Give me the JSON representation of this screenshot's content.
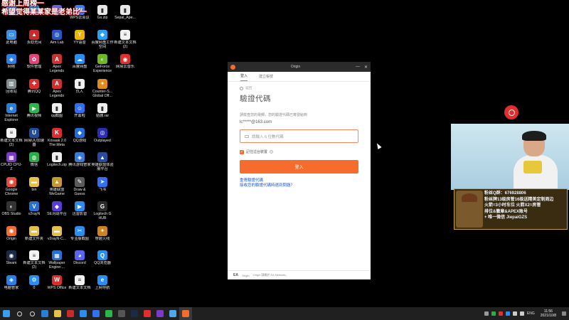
{
  "overlay_text": {
    "line1": "感谢上周榜一",
    "line2": "希望觉得某某家是老弟比一"
  },
  "desktop_icons": [
    {
      "label": "",
      "color": "#1e88e5",
      "glyph": "▣"
    },
    {
      "label": "",
      "color": "#1e88e5",
      "glyph": "▣"
    },
    {
      "label": "",
      "color": "#5b6bd6",
      "glyph": "✦"
    },
    {
      "label": "WPS云会议",
      "color": "#3b7cf5",
      "glyph": "W"
    },
    {
      "label": "Gs.zip",
      "color": "#e8e8e8",
      "glyph": "▮"
    },
    {
      "label": "Sepal_Ape...",
      "color": "#e8e8e8",
      "glyph": "▮"
    },
    {
      "label": "此电脑",
      "color": "#3a8ee6",
      "glyph": "▭"
    },
    {
      "label": "永劫无间",
      "color": "#c92a2a",
      "glyph": "▲"
    },
    {
      "label": "Aim Lab",
      "color": "#2756c4",
      "glyph": "◎"
    },
    {
      "label": "YY语音",
      "color": "#f0b400",
      "glyph": "Y"
    },
    {
      "label": "百度网盘工作空间",
      "color": "#27a1f5",
      "glyph": "◆"
    },
    {
      "label": "新建文本文档(2)",
      "color": "#f2f2f2",
      "glyph": "≡"
    },
    {
      "label": "网络",
      "color": "#2f7de1",
      "glyph": "◈"
    },
    {
      "label": "软件管理",
      "color": "#e2457a",
      "glyph": "✿"
    },
    {
      "label": "Apex Legends",
      "color": "#c83232",
      "glyph": "A"
    },
    {
      "label": "百度网盘",
      "color": "#2a8ef0",
      "glyph": "☁"
    },
    {
      "label": "GeForce Experience",
      "color": "#6fb62b",
      "glyph": "◐"
    },
    {
      "label": "网易云音乐",
      "color": "#e02f2f",
      "glyph": "◉"
    },
    {
      "label": "回收站",
      "color": "#7f8c8d",
      "glyph": "▥"
    },
    {
      "label": "腾讯QQ",
      "color": "#d62f2f",
      "glyph": "✚"
    },
    {
      "label": "Apex Legends",
      "color": "#c83232",
      "glyph": "A"
    },
    {
      "label": "仇人",
      "color": "#eeeeee",
      "glyph": "▮"
    },
    {
      "label": "Counter-S... Global Off...",
      "color": "#e28a1c",
      "glyph": "✦"
    },
    {
      "label": "",
      "color": "#000000",
      "glyph": ""
    },
    {
      "label": "Internet Explorer",
      "color": "#2a7fd4",
      "glyph": "e"
    },
    {
      "label": "腾讯视频",
      "color": "#2cb64a",
      "glyph": "▶"
    },
    {
      "label": "qq截图",
      "color": "#eeeeee",
      "glyph": "▮"
    },
    {
      "label": "开黑啦",
      "color": "#2d6ff0",
      "glyph": "☺"
    },
    {
      "label": "骷髅.rar",
      "color": "#eeeeee",
      "glyph": "▮"
    },
    {
      "label": "",
      "color": "#000000",
      "glyph": ""
    },
    {
      "label": "新建文本文档(2)",
      "color": "#f2f2f2",
      "glyph": "≡"
    },
    {
      "label": "网易UU加速器",
      "color": "#224a9a",
      "glyph": "U"
    },
    {
      "label": "Kovaak 2.0 The Meta",
      "color": "#d92e2e",
      "glyph": "K"
    },
    {
      "label": "QQ游戏",
      "color": "#1f6fd8",
      "glyph": "◆"
    },
    {
      "label": "Outplayed",
      "color": "#2c2cb4",
      "glyph": "◎"
    },
    {
      "label": "",
      "color": "#000000",
      "glyph": ""
    },
    {
      "label": "CPUID CPU-Z",
      "color": "#7c3ac9",
      "glyph": "▦"
    },
    {
      "label": "微信",
      "color": "#2aae49",
      "glyph": "◍"
    },
    {
      "label": "Logitech.zip",
      "color": "#eeeeee",
      "glyph": "▮"
    },
    {
      "label": "腾讯游戏管家",
      "color": "#3a7ad4",
      "glyph": "◈"
    },
    {
      "label": "英雄联盟体验服平台",
      "color": "#2a4a9c",
      "glyph": "▲"
    },
    {
      "label": "",
      "color": "#000000",
      "glyph": ""
    },
    {
      "label": "Google Chrome",
      "color": "#e24a3a",
      "glyph": "◉"
    },
    {
      "label": "bin",
      "color": "#e6c04a",
      "glyph": "▬"
    },
    {
      "label": "英雄联盟WeGame",
      "color": "#c59a2e",
      "glyph": "▲"
    },
    {
      "label": "Draw & Guess",
      "color": "#5a5a5a",
      "glyph": "✎"
    },
    {
      "label": "飞书",
      "color": "#3271f0",
      "glyph": "➤"
    },
    {
      "label": "",
      "color": "#000000",
      "glyph": ""
    },
    {
      "label": "OBS Studio",
      "color": "#333333",
      "glyph": "◐"
    },
    {
      "label": "v2rayN",
      "color": "#2a6fd0",
      "glyph": "V"
    },
    {
      "label": "SE对战平台",
      "color": "#5c3ad6",
      "glyph": "◆"
    },
    {
      "label": "迅雷影音",
      "color": "#2d8af0",
      "glyph": "▶"
    },
    {
      "label": "Logitech G HUB",
      "color": "#2b2b2b",
      "glyph": "G"
    },
    {
      "label": "",
      "color": "#000000",
      "glyph": ""
    },
    {
      "label": "Origin",
      "color": "#f56c2d",
      "glyph": "◉"
    },
    {
      "label": "新建文件夹",
      "color": "#e6c04a",
      "glyph": "▬"
    },
    {
      "label": "v2rayN-C...",
      "color": "#e6c04a",
      "glyph": "▬"
    },
    {
      "label": "专业版截图",
      "color": "#2a8ef0",
      "glyph": "✂"
    },
    {
      "label": "穿越火线",
      "color": "#d0831e",
      "glyph": "✦"
    },
    {
      "label": "",
      "color": "#000000",
      "glyph": ""
    },
    {
      "label": "Steam",
      "color": "#1b2a45",
      "glyph": "◉"
    },
    {
      "label": "新建文本文档(2)",
      "color": "#f2f2f2",
      "glyph": "≡"
    },
    {
      "label": "Wallpaper Engine:...",
      "color": "#2a6fd0",
      "glyph": "▦"
    },
    {
      "label": "Discord",
      "color": "#5865f2",
      "glyph": "◕"
    },
    {
      "label": "QQ浏览器",
      "color": "#2a8ef0",
      "glyph": "Q"
    },
    {
      "label": "",
      "color": "#000000",
      "glyph": ""
    },
    {
      "label": "电脑管家",
      "color": "#2a7fe6",
      "glyph": "◈"
    },
    {
      "label": "0",
      "color": "#2a8ef0",
      "glyph": "⚙"
    },
    {
      "label": "WPS Office",
      "color": "#d62f2f",
      "glyph": "W"
    },
    {
      "label": "新建文本文档",
      "color": "#f2f2f2",
      "glyph": "≡"
    },
    {
      "label": "上网导航",
      "color": "#2a8ef0",
      "glyph": "e"
    },
    {
      "label": "",
      "color": "#000000",
      "glyph": ""
    }
  ],
  "origin": {
    "title": "Origin",
    "tab_login": "登入",
    "tab_register": "建立帳號",
    "back_label": "返回",
    "heading": "驗證代碼",
    "description": "請檢查您的電郵，您的驗證代碼已寄發給到",
    "email": "lc*****@163.com",
    "code_placeholder": "請輸入 6 位數代碼",
    "remember_label": "記住這台裝置",
    "login_button": "登入",
    "resend_link": "重寄驗證代碼",
    "problem_link": "接收您的驗證代碼時遇到問題？",
    "footer_ea": "EA",
    "footer_origin": "Origin",
    "footer_text": "Origin 隸屬於 EA Network。"
  },
  "banner": {
    "line1": "粉丝Q群：676928806",
    "line2": "粉丝牌13级房管16级送精美定制周边",
    "line3": "火箭=3小时车位 火箭X2=房管",
    "line4": "排位&徽章&APEX账号",
    "line5": "+ 唯一微信  JiepaiGZS"
  },
  "taskbar": {
    "apps": [
      {
        "name": "windows-start",
        "color": "#3c9cf0"
      },
      {
        "name": "search",
        "color": "#dddddd"
      },
      {
        "name": "task-view",
        "color": "#dddddd"
      },
      {
        "name": "internet-explorer",
        "color": "#2a7fd4"
      },
      {
        "name": "file-explorer",
        "color": "#e6c04a"
      },
      {
        "name": "app-red",
        "color": "#c92a2a"
      },
      {
        "name": "app-blue",
        "color": "#2a8ef0"
      },
      {
        "name": "app-feishu",
        "color": "#3271f0"
      },
      {
        "name": "tencent-video",
        "color": "#2cb64a"
      },
      {
        "name": "obs",
        "color": "#555555"
      },
      {
        "name": "steam",
        "color": "#1b2a45"
      },
      {
        "name": "netease-music",
        "color": "#e02f2f"
      },
      {
        "name": "app-purple",
        "color": "#7c3ac9"
      },
      {
        "name": "app-lightblue",
        "color": "#4fa8e8"
      },
      {
        "name": "origin",
        "color": "#f56c2d"
      }
    ],
    "language": "ENG",
    "time": "11:56",
    "date": "2021/10/8"
  }
}
